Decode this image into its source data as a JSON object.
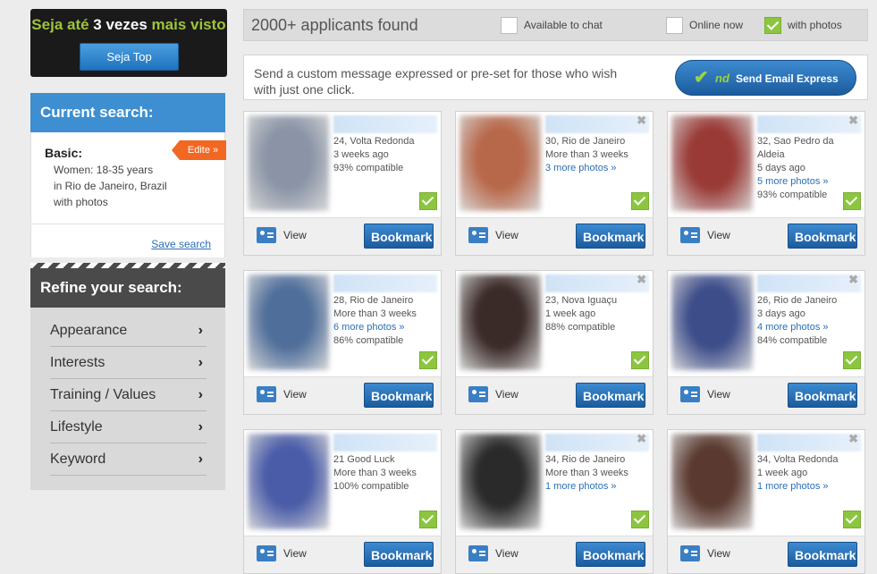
{
  "promo": {
    "title_part1": "Seja até",
    "title_part2": "3 vezes",
    "title_part3": "mais visto",
    "button": "Seja Top"
  },
  "current_search": {
    "title": "Current search:",
    "basic_label": "Basic:",
    "edit_label": "Edite »",
    "criteria": [
      "Women: 18-35 years",
      "in Rio de Janeiro, Brazil",
      "with photos"
    ],
    "save_link": "Save search"
  },
  "refine": {
    "title": "Refine your search:",
    "items": [
      "Appearance",
      "Interests",
      "Training / Values",
      "Lifestyle",
      "Keyword"
    ],
    "chevron": "›"
  },
  "topbar": {
    "count": "2000+ applicants found",
    "filters": [
      {
        "label": "Available to chat",
        "checked": false
      },
      {
        "label": "Online now",
        "checked": false
      },
      {
        "label": "with photos",
        "checked": true
      }
    ]
  },
  "message": {
    "text": "Send a custom message expressed or pre-set for those who wish with just one click.",
    "button_nd": "nd",
    "button": "Send Email Express"
  },
  "card_common": {
    "view": "View",
    "bookmark": "Bookmark",
    "close": "✖"
  },
  "cards": [
    {
      "lines": [
        "24, Volta Redonda",
        "3 weeks ago",
        "93% compatible"
      ],
      "link_line": -1,
      "photo_color": "#8a94a6"
    },
    {
      "lines": [
        "30, Rio de Janeiro",
        "More than 3 weeks",
        "3 more photos »"
      ],
      "link_line": 2,
      "photo_color": "#b8684a"
    },
    {
      "lines": [
        "32, Sao Pedro da",
        "Aldeia",
        "5 days ago",
        "5 more photos »",
        "93% compatible"
      ],
      "link_line": 3,
      "photo_color": "#9a3a36"
    },
    {
      "lines": [
        "28, Rio de Janeiro",
        "More than 3 weeks",
        "6 more photos »",
        "86% compatible"
      ],
      "link_line": 2,
      "photo_color": "#4f6e9a"
    },
    {
      "lines": [
        "23, Nova Iguaçu",
        "1 week ago",
        "88% compatible"
      ],
      "link_line": -1,
      "photo_color": "#3a2a28"
    },
    {
      "lines": [
        "26, Rio de Janeiro",
        "3 days ago",
        "4 more photos »",
        "84% compatible"
      ],
      "link_line": 2,
      "photo_color": "#3d4d8a"
    },
    {
      "lines": [
        "21 Good Luck",
        "More than 3 weeks",
        "100% compatible"
      ],
      "link_line": -1,
      "photo_color": "#4a5ca8"
    },
    {
      "lines": [
        "34, Rio de Janeiro",
        "More than 3 weeks",
        "1 more photos »"
      ],
      "link_line": 2,
      "photo_color": "#2a2a2a"
    },
    {
      "lines": [
        "34, Volta Redonda",
        "1 week ago",
        "1 more photos »"
      ],
      "link_line": 2,
      "photo_color": "#5a3a30"
    }
  ]
}
